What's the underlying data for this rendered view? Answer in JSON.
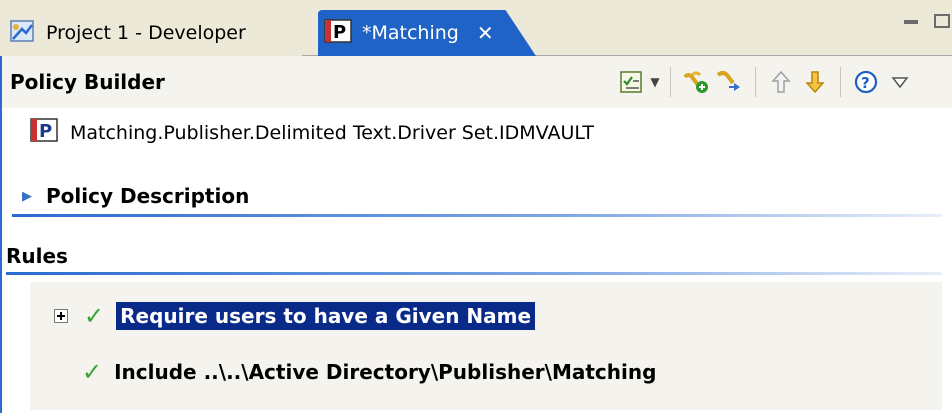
{
  "tabs": [
    {
      "label": "Project 1 - Developer",
      "icon": "project-designer-icon",
      "active": false
    },
    {
      "label": "*Matching",
      "icon": "policy-icon",
      "active": true,
      "close_symbol": "✕"
    }
  ],
  "header": {
    "title": "Policy Builder",
    "toolbar": [
      "outline-view-icon",
      "dropdown-arrow-icon",
      "new-rule-icon",
      "simulate-icon",
      "move-up-icon",
      "move-down-icon",
      "help-icon",
      "view-menu-icon"
    ]
  },
  "policy": {
    "icon": "policy-icon",
    "name": "Matching.Publisher.Delimited Text.Driver Set.IDMVAULT"
  },
  "sections": {
    "description": "Policy Description",
    "rules": "Rules"
  },
  "rules": [
    {
      "label": "Require users to have a Given Name",
      "enabled": true,
      "expandable": true,
      "selected": true
    },
    {
      "label": "Include ..\\..\\Active Directory\\Publisher\\Matching",
      "enabled": true,
      "expandable": false,
      "selected": false
    }
  ],
  "colors": {
    "active_tab": "#1f63c6",
    "selection": "#0a2a8a",
    "check": "#3aa33a",
    "section_rule": "#2a6bd1"
  }
}
